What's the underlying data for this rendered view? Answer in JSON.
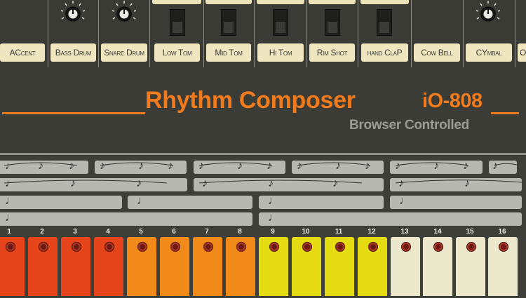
{
  "instruments": [
    {
      "label": "ACcent"
    },
    {
      "label": "Bass Drum"
    },
    {
      "label": "Snare Drum"
    },
    {
      "label": "Low Tom"
    },
    {
      "label": "Mid Tom"
    },
    {
      "label": "Hi Tom"
    },
    {
      "label": "Rim Shot"
    },
    {
      "label": "hand ClaP"
    },
    {
      "label": "Cow Bell"
    },
    {
      "label": "CYmbal"
    },
    {
      "label": "O"
    }
  ],
  "header": {
    "title": "Rhythm Composer",
    "model": "iO-808",
    "subtitle": "Browser Controlled"
  },
  "steps": [
    "1",
    "2",
    "3",
    "4",
    "5",
    "6",
    "7",
    "8",
    "9",
    "10",
    "11",
    "12",
    "13",
    "14",
    "15",
    "16"
  ],
  "colors": {
    "red": "#e6441b",
    "orange": "#f28a1a",
    "yellow": "#e5dc14",
    "cream": "#ebe8cc",
    "accent": "#f07a1c"
  }
}
